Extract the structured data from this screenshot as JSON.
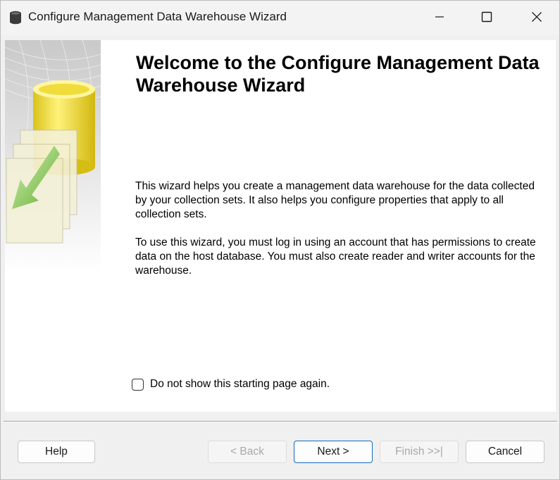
{
  "window": {
    "title": "Configure Management Data Warehouse Wizard",
    "icon": "database-icon",
    "controls": {
      "minimize": "minimize-icon",
      "maximize": "maximize-icon",
      "close": "close-icon"
    }
  },
  "page": {
    "heading": "Welcome to the Configure Management Data Warehouse Wizard",
    "paragraph1": "This wizard helps you create a management data warehouse for the data collected by your collection sets. It also helps you configure properties that apply to all collection sets.",
    "paragraph2": "To use this wizard, you must log in using an account that has permissions to create data on the host database. You must also create reader and writer accounts for the warehouse.",
    "checkbox": {
      "label": "Do not show this starting page again.",
      "checked": false
    }
  },
  "buttons": {
    "help": "Help",
    "back": "< Back",
    "next": "Next >",
    "finish": "Finish >>|",
    "cancel": "Cancel"
  },
  "colors": {
    "accent": "#0f6cbd",
    "art_cylinder": "#f2e24a",
    "art_arrow": "#7cc44a"
  }
}
